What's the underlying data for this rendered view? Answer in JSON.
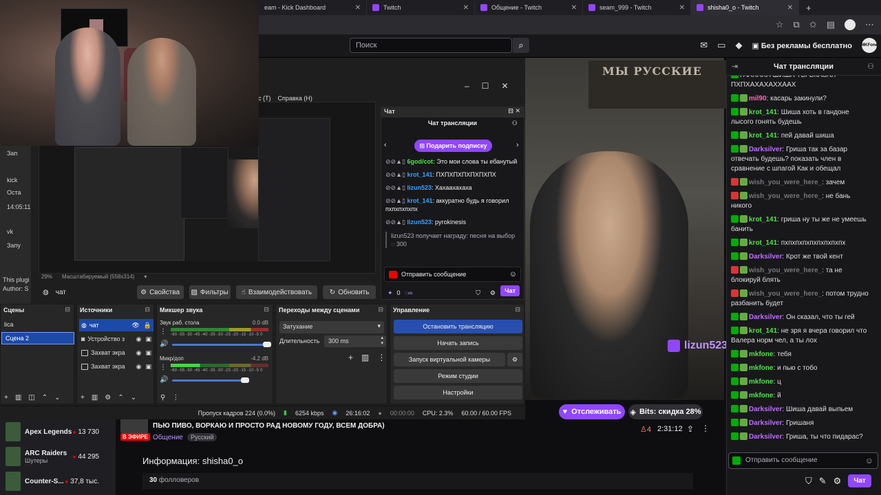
{
  "browser": {
    "tabs": [
      {
        "label": "eam - Kick Dashboard",
        "active": false
      },
      {
        "label": "Twitch",
        "active": false
      },
      {
        "label": "Общение - Twitch",
        "active": false
      },
      {
        "label": "seam_999 - Twitch",
        "active": false
      },
      {
        "label": "shisha0_o - Twitch",
        "active": true
      }
    ],
    "new_tab": "+"
  },
  "twitch": {
    "search_placeholder": "Поиск",
    "ad_free": "Без рекламы бесплатно",
    "avatar_text": "MKFone",
    "follow_button": "Отслеживать",
    "bits_button": "Bits: скидка 28%",
    "live_badge": "В ЭФИРЕ",
    "stream_title": "ПЬЮ ПИВО, ВОРКАЮ И ПРОСТО РАД НОВОМУ ГОДУ, ВСЕМ ДОБРА)",
    "category": "Общение",
    "language": "Русский",
    "viewers": "4",
    "uptime": "2:31:12",
    "info_heading": "Информация: shisha0_o",
    "followers_count": "30",
    "followers_label": "фолловеров",
    "video_watermark": "lizun523",
    "video_overlay_text": "pyrokinesis",
    "flag_text": "МЫ РУССКИЕ",
    "left_nav": [
      {
        "title": "Apex Legends",
        "sub": "",
        "count": "13 730"
      },
      {
        "title": "ARC Raiders",
        "sub": "Шутеры",
        "count": "44 295"
      },
      {
        "title": "Counter-S...",
        "sub": "",
        "count": "37,8 тыс."
      }
    ]
  },
  "chat": {
    "header": "Чат трансляции",
    "messages": [
      {
        "user": "",
        "text": "ГААХАХА ШИША ТЫ СКАЗАЛ ПХПХАХАХАХХААХ",
        "ucolor": "u-g",
        "badge": "b-green"
      },
      {
        "user": "mil90",
        "text": "касарь закинули?",
        "ucolor": "u-pk",
        "badge": "b-green"
      },
      {
        "user": "krot_141",
        "text": "Шиша хоть в гандоне лысого гонять будешь",
        "ucolor": "u-g",
        "badge": "b-green"
      },
      {
        "user": "krot_141",
        "text": "пей давай шиша",
        "ucolor": "u-g",
        "badge": "b-green"
      },
      {
        "user": "Darksilver",
        "text": "Гриша так за базар отвечать будешь? показать член в сравнение с шпагой Как и обещал",
        "ucolor": "u-p",
        "badge": "b-green"
      },
      {
        "user": "wish_you_were_here_",
        "text": "зачем",
        "ucolor": "u-gr",
        "badge": "b-red"
      },
      {
        "user": "wish_you_were_here_",
        "text": "не бань никого",
        "ucolor": "u-gr",
        "badge": "b-red"
      },
      {
        "user": "krot_141",
        "text": "гриша ну ты же не умеешь банить",
        "ucolor": "u-g",
        "badge": "b-green"
      },
      {
        "user": "krot_141",
        "text": "пхпхпхпхпхпхпхпхпх",
        "ucolor": "u-g",
        "badge": "b-green"
      },
      {
        "user": "Darksilver",
        "text": "Крот же твой кент",
        "ucolor": "u-p",
        "badge": "b-green"
      },
      {
        "user": "wish_you_were_here_",
        "text": "та не блокируй блять",
        "ucolor": "u-gr",
        "badge": "b-red"
      },
      {
        "user": "wish_you_were_here_",
        "text": "потом трудно разбанить будет",
        "ucolor": "u-gr",
        "badge": "b-red"
      },
      {
        "user": "Darksilver",
        "text": "Он сказал, что ты гей",
        "ucolor": "u-p",
        "badge": "b-green"
      },
      {
        "user": "krot_141",
        "text": "не зря я вчера говорил что Валера норм чел, а ты лох",
        "ucolor": "u-g",
        "badge": "b-green"
      },
      {
        "user": "mkfone",
        "text": "тебя",
        "ucolor": "u-g",
        "badge": "b-green"
      },
      {
        "user": "mkfone",
        "text": "и пью с тобо",
        "ucolor": "u-g",
        "badge": "b-green"
      },
      {
        "user": "mkfone",
        "text": "ц",
        "ucolor": "u-g",
        "badge": "b-green"
      },
      {
        "user": "mkfone",
        "text": "й",
        "ucolor": "u-g",
        "badge": "b-green"
      },
      {
        "user": "Darksilver",
        "text": "Шиша давай выпьем",
        "ucolor": "u-p",
        "badge": "b-green"
      },
      {
        "user": "Darksilver",
        "text": "Гришаня",
        "ucolor": "u-p",
        "badge": "b-green"
      },
      {
        "user": "Darksilver",
        "text": "Гриша, ты что пидарас?",
        "ucolor": "u-p",
        "badge": "b-green"
      }
    ],
    "input_placeholder": "Отправить сообщение",
    "send_button": "Чат"
  },
  "obs": {
    "menu": [
      "ис (T)",
      "Справка (H)"
    ],
    "left_labels": [
      "Зап",
      "kick",
      "Оста",
      "14:05:11",
      "vk",
      "Запу",
      "This plugi",
      "Author: S"
    ],
    "zoom": "29%",
    "scale_mode": "Масштабируемый (558x314)",
    "source_name": "чат",
    "buttons": {
      "properties": "Свойства",
      "filters": "Фильтры",
      "interact": "Взаимодействовать",
      "refresh": "Обновить"
    },
    "chat_dock": {
      "title": "Чат",
      "header": "Чат трансляции",
      "gift": "Подарить подписку",
      "messages": [
        {
          "user": "",
          "text": "Это мои слова ты ебанутый",
          "prefix": "6god/cot:"
        },
        {
          "user": "krot_141",
          "text": "ПХПХПХПХПХПХПХ"
        },
        {
          "user": "lizun523",
          "text": "Хахаахахаха"
        },
        {
          "user": "krot_141",
          "text": "аккуратно будь я говорил пхпхпхпхпх"
        },
        {
          "user": "lizun523",
          "text": "pyrokinesis"
        }
      ],
      "reward": "lizun523 получает награду: песня на выбор",
      "reward_cost": "300",
      "input_placeholder": "Отправить сообщение",
      "points": "0",
      "chat_button": "Чат"
    },
    "docks": {
      "scenes": {
        "title": "Сцены",
        "items": [
          "lica",
          "Сцена 2"
        ]
      },
      "sources": {
        "title": "Источники",
        "items": [
          "чат",
          "Устройство з",
          "Захват экра",
          "Захват экра"
        ]
      },
      "mixer": {
        "title": "Микшер звука",
        "channels": [
          {
            "name": "Звук раб. стола",
            "db": "0.0 dB"
          },
          {
            "name": "Микр/доп",
            "db": "-4.2 dB"
          }
        ],
        "scale": "-60 -55 -50 -45 -40 -35 -30 -25 -20 -15 -10 -5 0"
      },
      "transitions": {
        "title": "Переходы между сценами",
        "type": "Затухание",
        "duration_label": "Длительность",
        "duration": "300 ms"
      },
      "controls": {
        "title": "Управление",
        "buttons": [
          "Остановить трансляцию",
          "Начать запись",
          "Запуск виртуальной камеры",
          "Режим студии",
          "Настройки"
        ]
      }
    },
    "status": {
      "dropped": "Пропуск кадров 224 (0.0%)",
      "bitrate": "6254 kbps",
      "live_time": "26:16:02",
      "rec_time": "00:00:00",
      "cpu": "CPU: 2.3%",
      "fps": "60.00 / 60.00 FPS"
    }
  }
}
